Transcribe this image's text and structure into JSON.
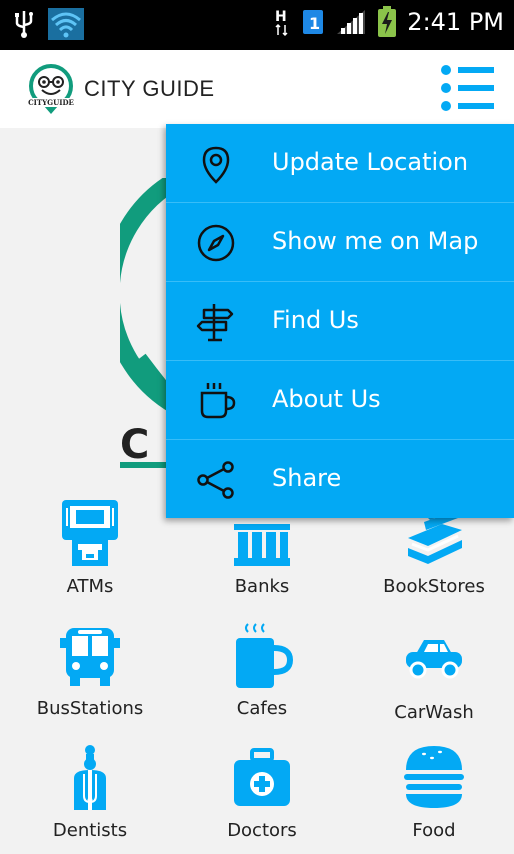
{
  "status_bar": {
    "time": "2:41 PM",
    "network_label": "H",
    "sim_badge": "1"
  },
  "app_bar": {
    "title": "CITY GUIDE",
    "logo_text": "CITYGUIDE"
  },
  "menu": {
    "items": [
      {
        "label": "Update Location",
        "icon": "location-pin-icon"
      },
      {
        "label": "Show me on Map",
        "icon": "compass-icon"
      },
      {
        "label": "Find Us",
        "icon": "signpost-icon"
      },
      {
        "label": "About Us",
        "icon": "coffee-cup-icon"
      },
      {
        "label": "Share",
        "icon": "share-icon"
      }
    ]
  },
  "categories": [
    {
      "label": "ATMs",
      "icon": "atm-icon"
    },
    {
      "label": "Banks",
      "icon": "bank-icon"
    },
    {
      "label": "BookStores",
      "icon": "books-icon"
    },
    {
      "label": "BusStations",
      "icon": "bus-icon"
    },
    {
      "label": "Cafes",
      "icon": "cafe-icon"
    },
    {
      "label": "CarWash",
      "icon": "car-icon"
    },
    {
      "label": "Dentists",
      "icon": "dentist-icon"
    },
    {
      "label": "Doctors",
      "icon": "medical-kit-icon"
    },
    {
      "label": "Food",
      "icon": "burger-icon"
    }
  ],
  "colors": {
    "accent": "#03a9f4",
    "logo_green": "#119c7d"
  }
}
